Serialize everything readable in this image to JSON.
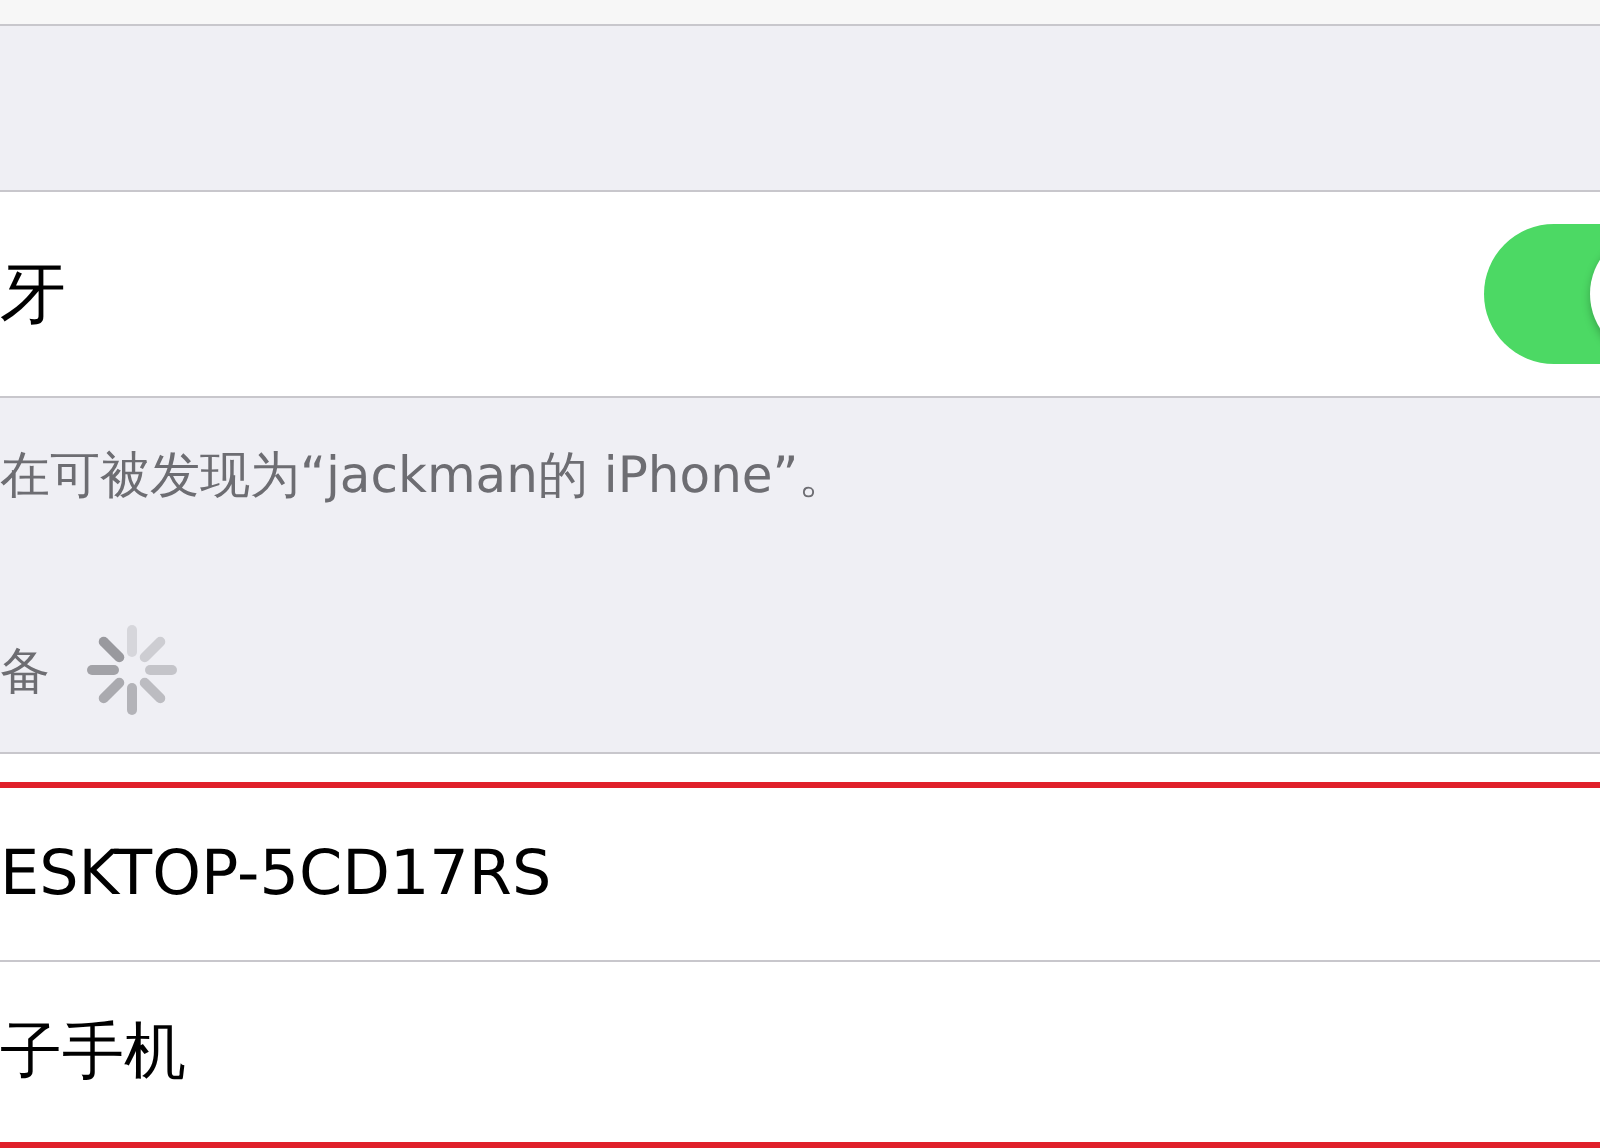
{
  "bluetooth": {
    "label": "牙",
    "on": true
  },
  "discoverable_note": "在可被发现为“jackman的 iPhone”。",
  "devices_section": {
    "title": "备",
    "searching": true
  },
  "devices_highlighted": true,
  "devices": [
    {
      "name": "ESKTOP-5CD17RS"
    },
    {
      "name": "子手机"
    }
  ]
}
